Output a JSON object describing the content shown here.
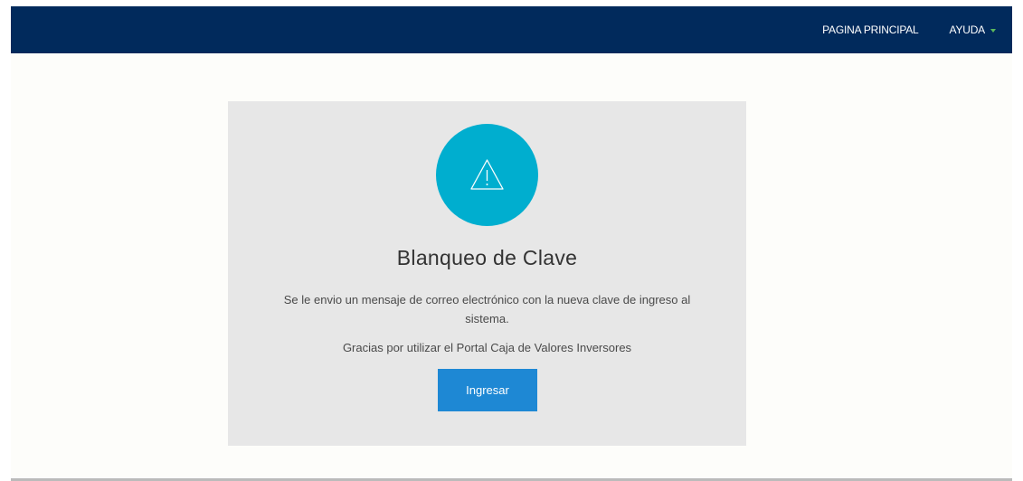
{
  "nav": {
    "home_label": "PAGINA PRINCIPAL",
    "help_label": "AYUDA",
    "background": "#012a5c",
    "caret_color": "#5cb85c"
  },
  "card": {
    "icon": "warning-triangle-icon",
    "icon_color": "#00aecf",
    "title": "Blanqueo de Clave",
    "message": "Se le envio un mensaje de correo electrónico con la nueva clave de ingreso al sistema.",
    "thanks": "Gracias por utilizar el Portal Caja de Valores Inversores",
    "button_label": "Ingresar",
    "button_color": "#1e88d4"
  }
}
